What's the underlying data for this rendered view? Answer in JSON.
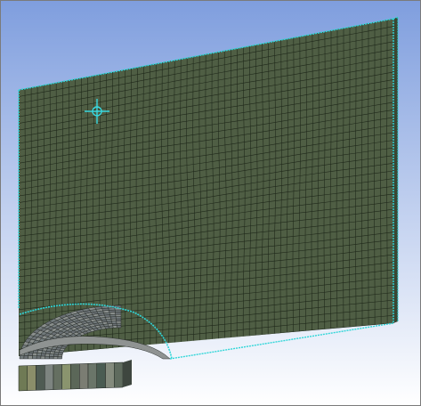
{
  "viewport": {
    "background_top": "#7f9ede",
    "background_bottom": "#ffffff"
  },
  "mesh": {
    "face_color": "#4f5e44",
    "line_color": "#182014",
    "edge_color": "#2fd6d8",
    "fillet_colors": [
      "#727a7c",
      "#8a8f8d",
      "#6b7175"
    ],
    "bar_colors": [
      "#6f7a55",
      "#8b8e6a",
      "#4f5b53",
      "#7d8480",
      "#656f61",
      "#8a946e",
      "#5b6758",
      "#7b7d73",
      "#6a7569",
      "#4a5c52",
      "#848b7d",
      "#5f6b5e"
    ]
  },
  "cursor": {
    "icon": "crosshair-icon",
    "color": "#39d8e0"
  }
}
